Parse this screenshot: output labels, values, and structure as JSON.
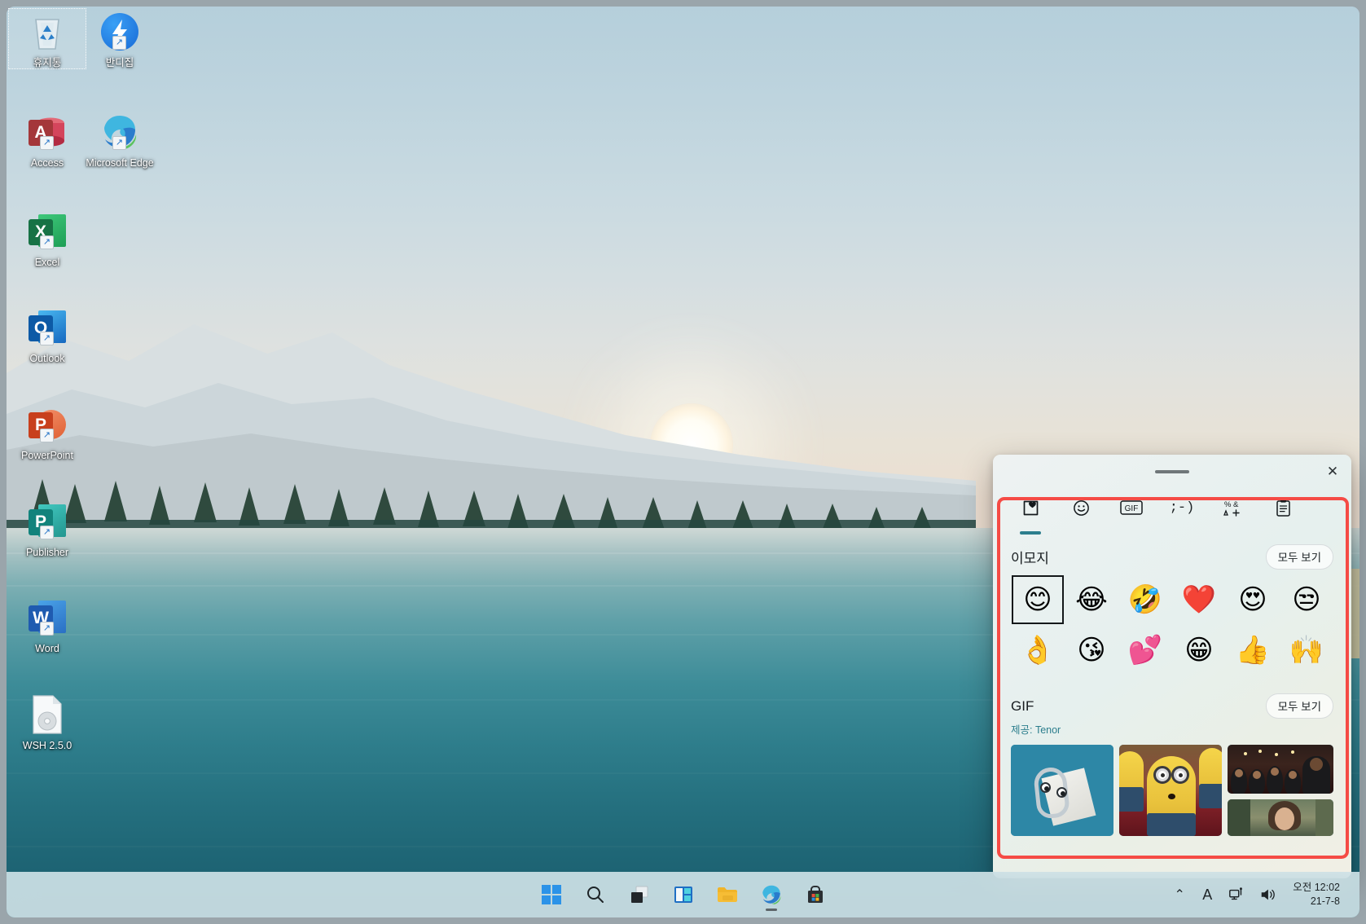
{
  "desktop": {
    "icons": [
      {
        "label": "휴지통",
        "icon": "recycle-bin-icon",
        "selected": true,
        "shortcut": false
      },
      {
        "label": "반디집",
        "icon": "bandizip-icon",
        "selected": false,
        "shortcut": true
      },
      {
        "label": "Access",
        "icon": "access-icon",
        "selected": false,
        "shortcut": true
      },
      {
        "label": "Microsoft Edge",
        "icon": "edge-icon",
        "selected": false,
        "shortcut": true
      },
      {
        "label": "Excel",
        "icon": "excel-icon",
        "selected": false,
        "shortcut": true
      },
      {
        "label": "Outlook",
        "icon": "outlook-icon",
        "selected": false,
        "shortcut": true
      },
      {
        "label": "PowerPoint",
        "icon": "powerpoint-icon",
        "selected": false,
        "shortcut": true
      },
      {
        "label": "Publisher",
        "icon": "publisher-icon",
        "selected": false,
        "shortcut": true
      },
      {
        "label": "Word",
        "icon": "word-icon",
        "selected": false,
        "shortcut": true
      },
      {
        "label": "WSH 2.5.0",
        "icon": "disc-document-icon",
        "selected": false,
        "shortcut": false
      }
    ]
  },
  "emoji_panel": {
    "close_label": "✕",
    "tabs": [
      {
        "name": "recent",
        "icon": "recent-heart-icon",
        "glyph": "",
        "active": true
      },
      {
        "name": "emoji",
        "icon": "smiley-face-icon",
        "glyph": "☺",
        "active": false
      },
      {
        "name": "gif",
        "icon": "gif-icon",
        "glyph": "GIF",
        "active": false
      },
      {
        "name": "kaomoji",
        "icon": "kaomoji-icon",
        "glyph": ";-)",
        "active": false
      },
      {
        "name": "symbols",
        "icon": "symbols-icon",
        "glyph": "",
        "active": false
      },
      {
        "name": "clipboard",
        "icon": "clipboard-icon",
        "glyph": "",
        "active": false
      }
    ],
    "emoji_section": {
      "title": "이모지",
      "see_all_label": "모두 보기",
      "emojis": [
        {
          "char": "😊",
          "name": "smiling-face-with-smiling-eyes",
          "focused": true
        },
        {
          "char": "😂",
          "name": "face-with-tears-of-joy",
          "focused": false
        },
        {
          "char": "🤣",
          "name": "rolling-on-the-floor-laughing",
          "focused": false
        },
        {
          "char": "❤️",
          "name": "red-heart",
          "focused": false
        },
        {
          "char": "😍",
          "name": "smiling-face-with-heart-eyes",
          "focused": false
        },
        {
          "char": "😒",
          "name": "unamused-face",
          "focused": false
        },
        {
          "char": "👌",
          "name": "ok-hand",
          "focused": false
        },
        {
          "char": "😘",
          "name": "face-blowing-a-kiss",
          "focused": false
        },
        {
          "char": "💕",
          "name": "two-hearts",
          "focused": false
        },
        {
          "char": "😁",
          "name": "beaming-face-with-smiling-eyes",
          "focused": false
        },
        {
          "char": "👍",
          "name": "thumbs-up",
          "focused": false
        },
        {
          "char": "🙌",
          "name": "raising-hands",
          "focused": false
        }
      ]
    },
    "gif_section": {
      "title": "GIF",
      "see_all_label": "모두 보기",
      "provider_note": "제공: Tenor",
      "thumbs": [
        {
          "name": "gif-thumb-clippy"
        },
        {
          "name": "gif-thumb-minions"
        },
        {
          "name": "gif-thumb-awards-applause"
        },
        {
          "name": "gif-thumb-tv-scene"
        }
      ]
    }
  },
  "taskbar": {
    "items": [
      {
        "name": "start-button",
        "label": "시작"
      },
      {
        "name": "search-button",
        "label": "검색"
      },
      {
        "name": "task-view-button",
        "label": "작업 보기"
      },
      {
        "name": "widgets-button",
        "label": "위젯"
      },
      {
        "name": "file-explorer-button",
        "label": "파일 탐색기"
      },
      {
        "name": "edge-button",
        "label": "Microsoft Edge"
      },
      {
        "name": "microsoft-store-button",
        "label": "Microsoft Store"
      }
    ],
    "tray": {
      "overflow_label": "⌃",
      "ime_label": "A",
      "network_label": "네트워크",
      "volume_label": "볼륨",
      "time": "오전 12:02",
      "date": "21-7-8"
    }
  },
  "colors": {
    "accent_teal": "#2c7e8d",
    "highlight_red": "#f54b45",
    "taskbar_bg": "#d6e7ec"
  }
}
